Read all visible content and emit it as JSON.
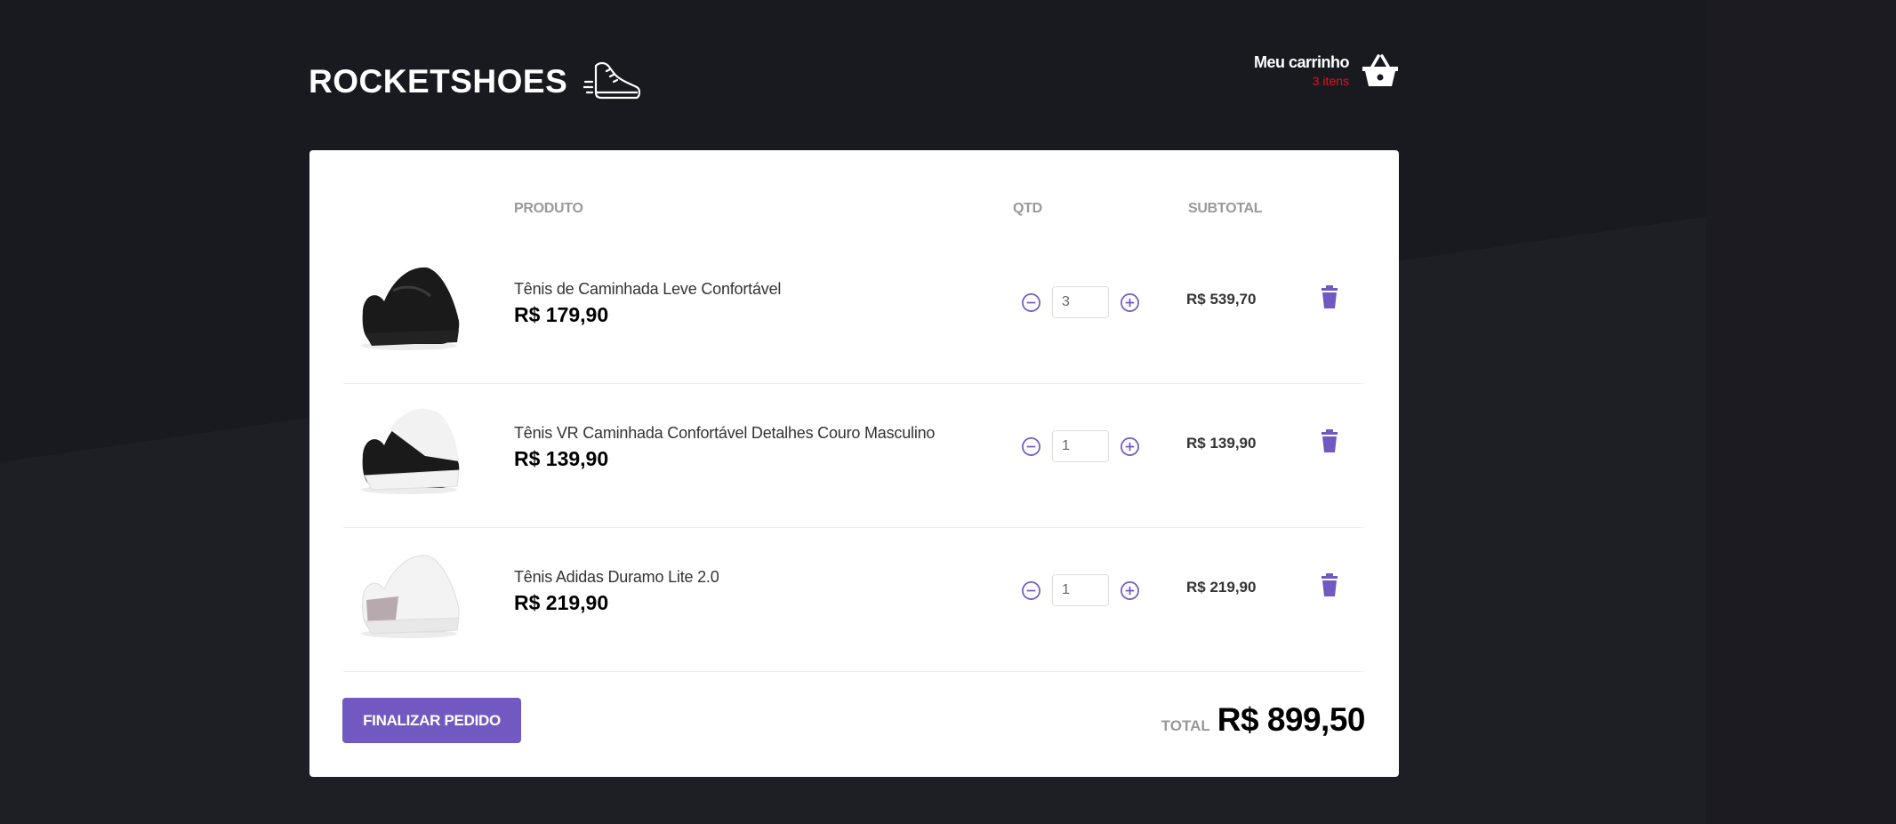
{
  "header": {
    "logo_text": "ROCKETSHOES",
    "cart_title": "Meu carrinho",
    "cart_count": "3 itens"
  },
  "table": {
    "col_produto": "PRODUTO",
    "col_qtd": "QTD",
    "col_subtotal": "SUBTOTAL"
  },
  "items": [
    {
      "name": "Tênis de Caminhada Leve Confortável",
      "price": "R$ 179,90",
      "qty": "3",
      "subtotal": "R$ 539,70",
      "shoe_color": "#1a1a1a",
      "sole_color": "#222"
    },
    {
      "name": "Tênis VR Caminhada Confortável Detalhes Couro Masculino",
      "price": "R$ 139,90",
      "qty": "1",
      "subtotal": "R$ 139,90",
      "shoe_color": "#1a1a1a",
      "sole_color": "#f2f2f2"
    },
    {
      "name": "Tênis Adidas Duramo Lite 2.0",
      "price": "R$ 219,90",
      "qty": "1",
      "subtotal": "R$ 219,90",
      "shoe_color": "#f3f3f3",
      "sole_color": "#e8e8e8"
    }
  ],
  "footer": {
    "finalize_label": "FINALIZAR PEDIDO",
    "total_label": "TOTAL",
    "total_value": "R$ 899,50"
  },
  "colors": {
    "accent": "#7159c1",
    "cart_count": "#e8101b",
    "background": "#191920"
  },
  "icons": [
    "sneaker-icon",
    "shopping-basket-icon",
    "minus-circle-icon",
    "plus-circle-icon",
    "trash-icon"
  ]
}
